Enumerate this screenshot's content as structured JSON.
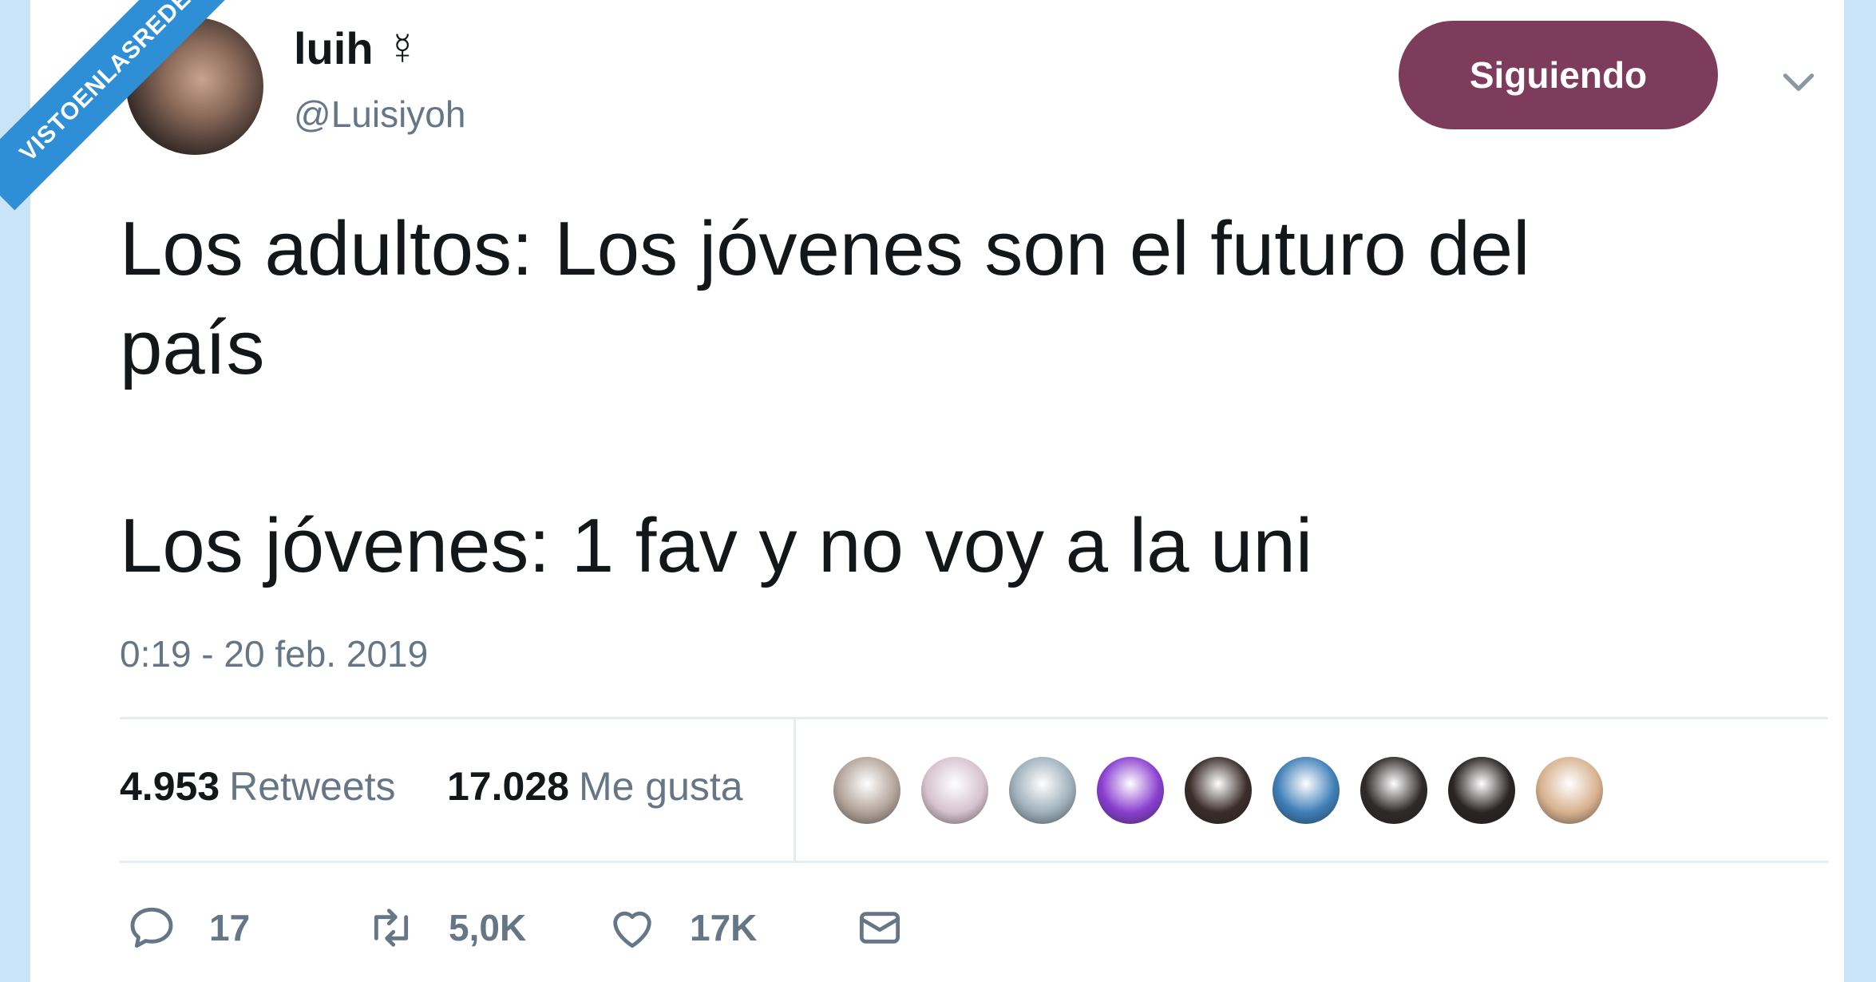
{
  "watermark": {
    "text": "VISTOENLASREDES"
  },
  "tweet": {
    "author_name": "luih ☿",
    "author_handle": "@Luisiyoh",
    "follow_label": "Siguiendo",
    "text": "Los adultos: Los jóvenes son el futuro del\npaís\n\nLos jóvenes: 1 fav y no voy a la uni",
    "timestamp": "0:19 - 20 feb. 2019"
  },
  "stats": {
    "retweets_count": "4.953",
    "retweets_label": "Retweets",
    "likes_count": "17.028",
    "likes_label": "Me gusta"
  },
  "likers": [
    {
      "color": "#b3a49a"
    },
    {
      "color": "#d6c3cf"
    },
    {
      "color": "#9fb0bb"
    },
    {
      "color": "#8a3fd0"
    },
    {
      "color": "#3a2d2a"
    },
    {
      "color": "#3f7fb8"
    },
    {
      "color": "#2f2a2a"
    },
    {
      "color": "#2a2424"
    },
    {
      "color": "#d8b28f"
    }
  ],
  "actions": {
    "reply_count": "17",
    "retweet_count": "5,0K",
    "like_count": "17K"
  },
  "colors": {
    "accent": "#7d3c5b",
    "secondary_text": "#657786",
    "background": "#c9e4f7",
    "ribbon": "#2f8fd6"
  },
  "icons": [
    "chevron-down-icon",
    "reply-icon",
    "retweet-icon",
    "like-icon",
    "message-icon"
  ]
}
